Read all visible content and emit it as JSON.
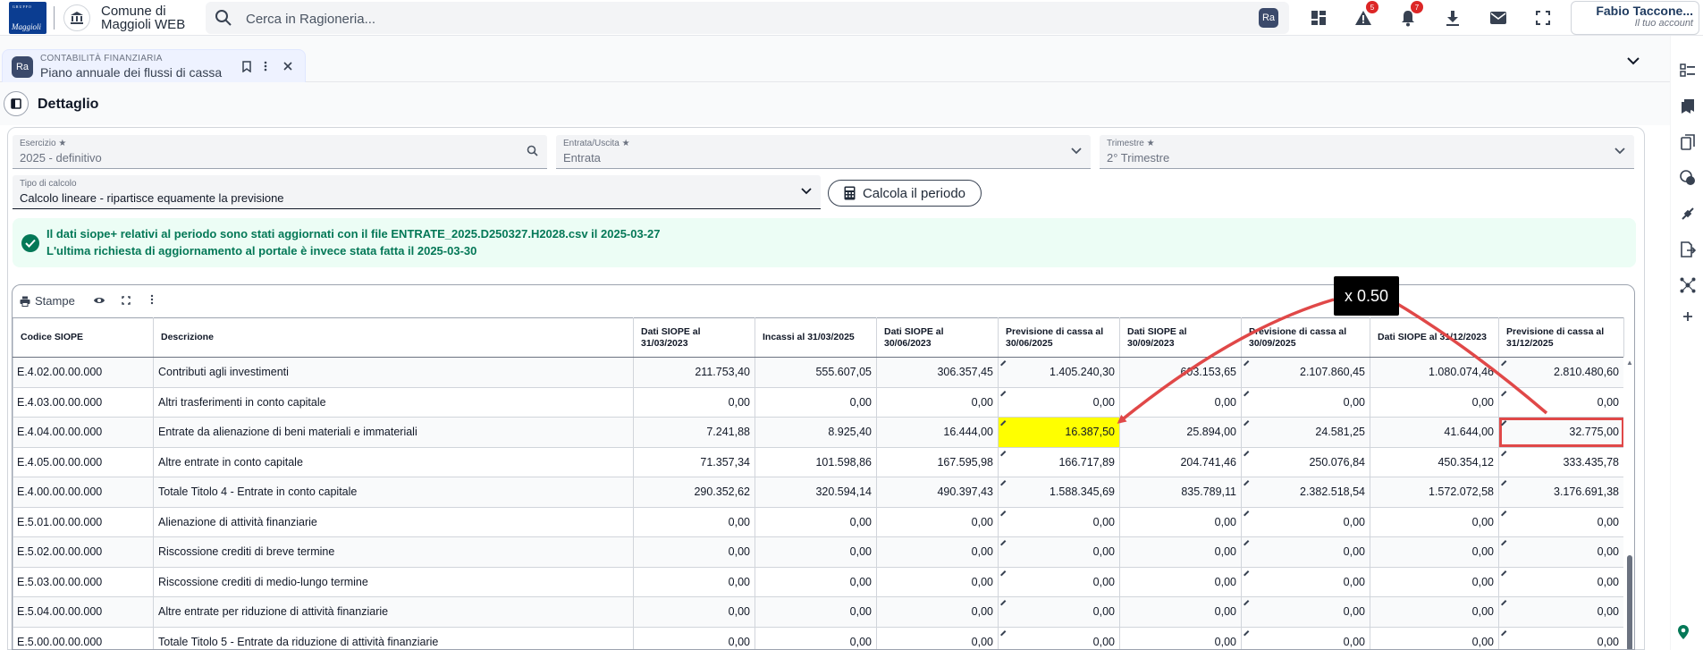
{
  "topbar": {
    "org_line1": "Comune di",
    "org_line2": "Maggioli WEB",
    "search_placeholder": "Cerca in Ragioneria...",
    "ra_label": "Ra",
    "alerts_count": "5",
    "notifications_count": "7",
    "user_name": "Fabio Taccone...",
    "user_role": "Il tuo account",
    "logo_small": "GRUPPO",
    "logo_big": "Maggioli"
  },
  "tab": {
    "category": "CONTABILITÀ FINANZIARIA",
    "title": "Piano annuale dei flussi di cassa",
    "ra_label": "Ra"
  },
  "detail": {
    "title": "Dettaglio"
  },
  "form": {
    "esercizio": {
      "label": "Esercizio ★",
      "value": "2025 - definitivo"
    },
    "entrata_uscita": {
      "label": "Entrata/Uscita ★",
      "value": "Entrata"
    },
    "trimestre": {
      "label": "Trimestre ★",
      "value": "2° Trimestre"
    },
    "tipo_calcolo": {
      "label": "Tipo di calcolo",
      "value": "Calcolo lineare - ripartisce equamente la previsione"
    },
    "calc_button": "Calcola il periodo"
  },
  "notice": {
    "line1": "Il dati siope+ relativi al periodo sono stati aggiornati con il file ENTRATE_2025.D250327.H2028.csv il 2025-03-27",
    "line2": "L'ultima richiesta di aggiornamento al portale è invece stata fatta il 2025-03-30"
  },
  "table_toolbar": {
    "print_label": "Stampe"
  },
  "table": {
    "headers": [
      "Codice SIOPE",
      "Descrizione",
      "Dati SIOPE al 31/03/2023",
      "Incassi al 31/03/2025",
      "Dati SIOPE al 30/06/2023",
      "Previsione di cassa al 30/06/2025",
      "Dati SIOPE al 30/09/2023",
      "Previsione di cassa al 30/09/2025",
      "Dati SIOPE al 31/12/2023",
      "Previsione di cassa al 31/12/2025"
    ],
    "rows": [
      [
        "E.4.02.00.00.000",
        "Contributi agli investimenti",
        "211.753,40",
        "555.607,05",
        "306.357,45",
        "1.405.240,30",
        "603.153,65",
        "2.107.860,45",
        "1.080.074,46",
        "2.810.480,60"
      ],
      [
        "E.4.03.00.00.000",
        "Altri trasferimenti in conto capitale",
        "0,00",
        "0,00",
        "0,00",
        "0,00",
        "0,00",
        "0,00",
        "0,00",
        "0,00"
      ],
      [
        "E.4.04.00.00.000",
        "Entrate da alienazione di beni materiali e immateriali",
        "7.241,88",
        "8.925,40",
        "16.444,00",
        "16.387,50",
        "25.894,00",
        "24.581,25",
        "41.644,00",
        "32.775,00"
      ],
      [
        "E.4.05.00.00.000",
        "Altre entrate in conto capitale",
        "71.357,34",
        "101.598,86",
        "167.595,98",
        "166.717,89",
        "204.741,46",
        "250.076,84",
        "450.354,12",
        "333.435,78"
      ],
      [
        "E.4.00.00.00.000",
        "Totale Titolo 4 - Entrate in conto capitale",
        "290.352,62",
        "320.594,14",
        "490.397,43",
        "1.588.345,69",
        "835.789,11",
        "2.382.518,54",
        "1.572.072,58",
        "3.176.691,38"
      ],
      [
        "E.5.01.00.00.000",
        "Alienazione di attività finanziarie",
        "0,00",
        "0,00",
        "0,00",
        "0,00",
        "0,00",
        "0,00",
        "0,00",
        "0,00"
      ],
      [
        "E.5.02.00.00.000",
        "Riscossione crediti di breve termine",
        "0,00",
        "0,00",
        "0,00",
        "0,00",
        "0,00",
        "0,00",
        "0,00",
        "0,00"
      ],
      [
        "E.5.03.00.00.000",
        "Riscossione crediti di medio-lungo termine",
        "0,00",
        "0,00",
        "0,00",
        "0,00",
        "0,00",
        "0,00",
        "0,00",
        "0,00"
      ],
      [
        "E.5.04.00.00.000",
        "Altre entrate per riduzione di attività finanziarie",
        "0,00",
        "0,00",
        "0,00",
        "0,00",
        "0,00",
        "0,00",
        "0,00",
        "0,00"
      ],
      [
        "E.5.00.00.00.000",
        "Totale Titolo 5 - Entrate da riduzione di attività finanziarie",
        "0,00",
        "0,00",
        "0,00",
        "0,00",
        "0,00",
        "0,00",
        "0,00",
        "0,00"
      ]
    ]
  },
  "annotation": {
    "ratio_label": "x 0.50",
    "arrow_color": "#e04848",
    "highlight_color": "#ffff00"
  }
}
